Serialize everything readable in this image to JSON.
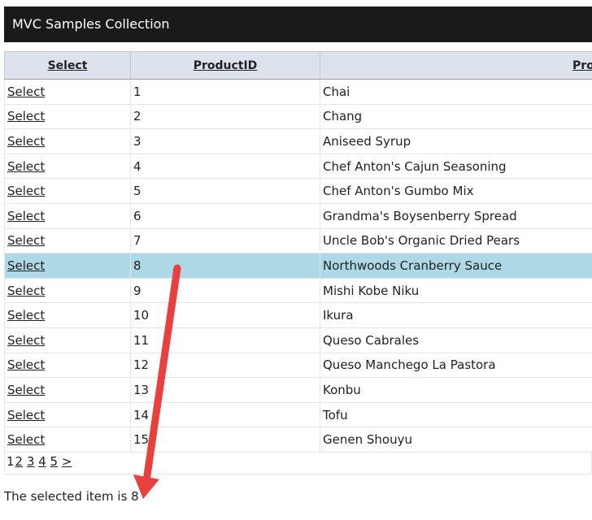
{
  "header": {
    "title": "MVC Samples Collection"
  },
  "grid": {
    "columns": [
      "Select",
      "ProductID",
      "Pro"
    ],
    "rows": [
      {
        "select": "Select",
        "id": "1",
        "name": "Chai"
      },
      {
        "select": "Select",
        "id": "2",
        "name": "Chang"
      },
      {
        "select": "Select",
        "id": "3",
        "name": "Aniseed Syrup"
      },
      {
        "select": "Select",
        "id": "4",
        "name": "Chef Anton's Cajun Seasoning"
      },
      {
        "select": "Select",
        "id": "5",
        "name": "Chef Anton's Gumbo Mix"
      },
      {
        "select": "Select",
        "id": "6",
        "name": "Grandma's Boysenberry Spread"
      },
      {
        "select": "Select",
        "id": "7",
        "name": "Uncle Bob's Organic Dried Pears"
      },
      {
        "select": "Select",
        "id": "8",
        "name": "Northwoods Cranberry Sauce"
      },
      {
        "select": "Select",
        "id": "9",
        "name": "Mishi Kobe Niku"
      },
      {
        "select": "Select",
        "id": "10",
        "name": "Ikura"
      },
      {
        "select": "Select",
        "id": "11",
        "name": "Queso Cabrales"
      },
      {
        "select": "Select",
        "id": "12",
        "name": "Queso Manchego La Pastora"
      },
      {
        "select": "Select",
        "id": "13",
        "name": "Konbu"
      },
      {
        "select": "Select",
        "id": "14",
        "name": "Tofu"
      },
      {
        "select": "Select",
        "id": "15",
        "name": "Genen Shouyu"
      }
    ],
    "selected_index": 7,
    "selected_color": "#add8e6"
  },
  "pager": {
    "current": "1",
    "pages": [
      "2",
      "3",
      "4",
      "5"
    ],
    "next": ">"
  },
  "status": {
    "text": "The selected item is 8"
  },
  "annotation": {
    "arrow_color": "#e8403f"
  }
}
